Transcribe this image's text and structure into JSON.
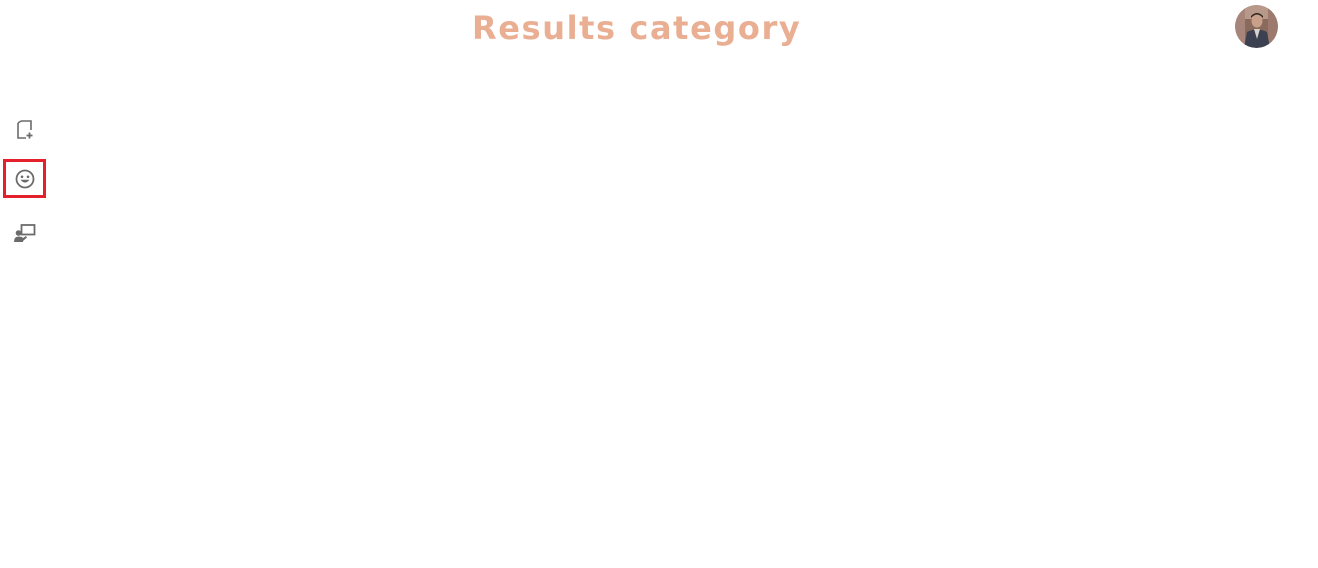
{
  "header": {
    "title": "Results category"
  },
  "colors": {
    "title": "#eaae92",
    "icon": "#6b6b6b",
    "selection_outline": "#e3202b",
    "background": "#ffffff"
  },
  "user": {
    "avatar_icon": "user-photo-avatar"
  },
  "sidebar": {
    "items": [
      {
        "icon": "add-page-icon",
        "selected": false
      },
      {
        "icon": "smiley-icon",
        "selected": true
      },
      {
        "icon": "presenter-icon",
        "selected": false
      }
    ]
  }
}
